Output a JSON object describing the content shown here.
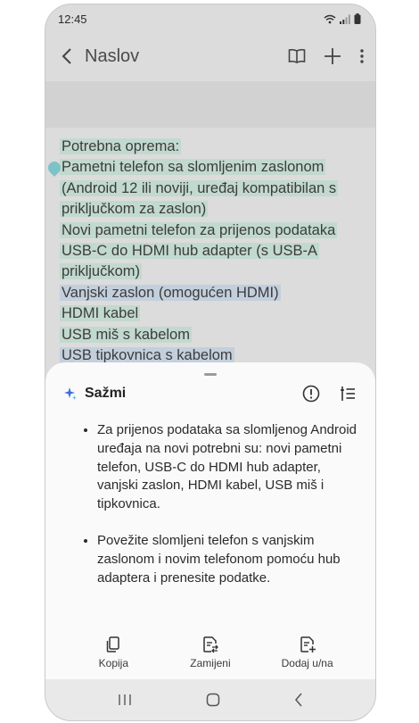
{
  "status_bar": {
    "time": "12:45"
  },
  "app_bar": {
    "title": "Naslov"
  },
  "note": {
    "lines": [
      "Potrebna oprema:",
      "Pametni telefon sa slomljenim zaslonom",
      "(Android 12 ili noviji, uređaj kompatibilan s",
      "priključkom za zaslon)",
      "Novi pametni telefon za prijenos podataka",
      "USB-C do HDMI hub adapter (s USB-A",
      "priključkom)",
      "Vanjski zaslon (omogućen HDMI)",
      "HDMI kabel",
      "USB miš s kabelom",
      "USB tipkovnica s kabelom"
    ]
  },
  "sheet": {
    "title": "Sažmi",
    "summary": [
      "Za prijenos podataka sa slomljenog Android uređaja na novi potrebni su: novi pametni telefon, USB-C do HDMI hub adapter, vanjski zaslon, HDMI kabel, USB miš i tipkovnica.",
      "Povežite slomljeni telefon s vanjskim zaslonom i novim telefonom pomoću hub adaptera i prenesite podatke."
    ],
    "actions": {
      "copy": "Kopija",
      "replace": "Zamijeni",
      "add": "Dodaj u/na"
    }
  },
  "colors": {
    "highlight_green": "#c2d9cf",
    "highlight_blue": "#c3cfdc",
    "ai_star": "#3b6ee0"
  },
  "icons": [
    "back-arrow-icon",
    "book-icon",
    "plus-icon",
    "more-vert-icon",
    "sparkle-icon",
    "info-icon",
    "summary-format-icon",
    "copy-icon",
    "replace-icon",
    "add-note-icon",
    "recents-icon",
    "home-icon",
    "back-icon",
    "wifi-icon",
    "signal-icon",
    "battery-icon"
  ]
}
